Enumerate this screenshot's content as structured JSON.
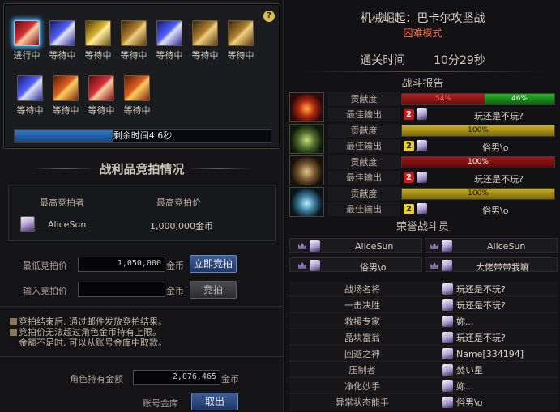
{
  "bid_status": {
    "help_glyph": "?",
    "slots": [
      {
        "state": "进行中",
        "icon": "red-loot-box-icon",
        "color": "red"
      },
      {
        "state": "等待中",
        "icon": "blue-loot-box-icon",
        "color": "blue"
      },
      {
        "state": "等待中",
        "icon": "gold-loot-box-icon",
        "color": "gold"
      },
      {
        "state": "等待中",
        "icon": "brown-loot-box-icon",
        "color": "brown"
      },
      {
        "state": "等待中",
        "icon": "blue-loot-box-icon",
        "color": "blue"
      },
      {
        "state": "等待中",
        "icon": "brown-loot-box-icon",
        "color": "brown"
      },
      {
        "state": "等待中",
        "icon": "brown-loot-box-icon",
        "color": "brown"
      },
      {
        "state": "等待中",
        "icon": "blue-loot-box-icon",
        "color": "blue"
      },
      {
        "state": "等待中",
        "icon": "orange-loot-box-icon",
        "color": "orange"
      },
      {
        "state": "等待中",
        "icon": "red-loot-box-icon",
        "color": "red"
      },
      {
        "state": "等待中",
        "icon": "orange-loot-box-icon",
        "color": "orange"
      }
    ],
    "time_remaining_label": "剩余时间4.6秒",
    "time_remaining_fraction": 0.38
  },
  "auction": {
    "title": "战利品竞拍情况",
    "header_bidder": "最高竞拍者",
    "header_price": "最高竞拍价",
    "top_bidder": "AliceSun",
    "top_price": "1,000,000金币",
    "min_bid_label": "最低竞拍价",
    "min_bid_value": "1,050,000",
    "currency": "金币",
    "instant_bid_button": "立即竞拍",
    "enter_bid_label": "输入竞拍价",
    "enter_bid_value": "",
    "bid_button": "竞拍",
    "notes": [
      "竞拍结束后, 通过邮件发放竞拍结果。",
      "竞拍价无法超过角色金币持有上限。",
      "金额不足时, 可以从账号金库中取款。"
    ],
    "gold_label": "角色持有金额",
    "gold_value": "2,076,465",
    "vault_label": "账号金库",
    "withdraw_button": "取出"
  },
  "result": {
    "dungeon_title": "机械崛起：巴卡尔攻坚战",
    "difficulty": "困难模式",
    "clear_time_label": "通关时间",
    "clear_time_value": "10分29秒",
    "battle_report_title": "战斗报告",
    "contribution_label": "贡献度",
    "top_output_label": "最佳输出",
    "parties": [
      {
        "portrait": "fire-boss-portrait",
        "style": "fire",
        "bars": [
          {
            "value": 54,
            "label": "54%",
            "color": "red"
          },
          {
            "value": 46,
            "label": "46%",
            "color": "green"
          }
        ],
        "rank": "2",
        "rank_color": "red",
        "player": "玩还是不玩?"
      },
      {
        "portrait": "green-boss-portrait",
        "style": "green",
        "bars": [
          {
            "value": 100,
            "label": "100%",
            "color": "yellow"
          }
        ],
        "rank": "2",
        "rank_color": "yellow",
        "player": "俗男\\o"
      },
      {
        "portrait": "brown-boss-portrait",
        "style": "brown",
        "bars": [
          {
            "value": 100,
            "label": "100%",
            "color": "darkred"
          }
        ],
        "rank": "2",
        "rank_color": "red",
        "player": "玩还是不玩?"
      },
      {
        "portrait": "cyan-boss-portrait",
        "style": "cyan",
        "bars": [
          {
            "value": 100,
            "label": "100%",
            "color": "yellow"
          }
        ],
        "rank": "2",
        "rank_color": "yellow",
        "player": "俗男\\o"
      }
    ],
    "honor_title": "荣誉战斗员",
    "honor_members": [
      "AliceSun",
      "AliceSun",
      "俗男\\o",
      "大佬带带我嘛"
    ],
    "titles": [
      {
        "title": "战场名将",
        "player": "玩还是不玩?"
      },
      {
        "title": "一击决胜",
        "player": "玩还是不玩?"
      },
      {
        "title": "救援专家",
        "player": "妳..."
      },
      {
        "title": "晶块富翁",
        "player": "玩还是不玩?"
      },
      {
        "title": "回避之神",
        "player": "Name[334194]"
      },
      {
        "title": "压制者",
        "player": "焚い星"
      },
      {
        "title": "净化妙手",
        "player": "妳..."
      },
      {
        "title": "异常状态能手",
        "player": "俗男\\o"
      }
    ]
  }
}
